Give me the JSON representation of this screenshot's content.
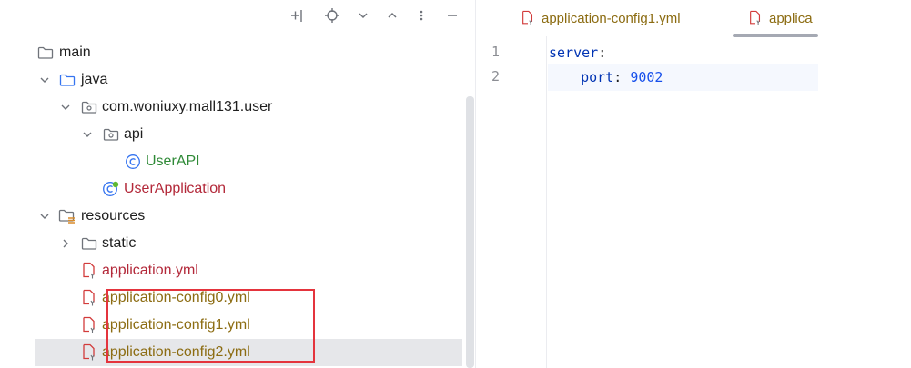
{
  "project_tree": {
    "items": [
      {
        "label": "main",
        "icon": "folder-icon",
        "expanded": null
      },
      {
        "label": "java",
        "icon": "source-folder-icon",
        "expanded": true
      },
      {
        "label": "com.woniuxy.mall131.user",
        "icon": "package-icon",
        "expanded": true
      },
      {
        "label": "api",
        "icon": "package-icon",
        "expanded": true
      },
      {
        "label": "UserAPI",
        "icon": "class-icon"
      },
      {
        "label": "UserApplication",
        "icon": "spring-boot-class-icon"
      },
      {
        "label": "resources",
        "icon": "resources-folder-icon",
        "expanded": true
      },
      {
        "label": "static",
        "icon": "folder-icon",
        "expanded": false
      },
      {
        "label": "application.yml",
        "icon": "yaml-file-icon"
      },
      {
        "label": "application-config0.yml",
        "icon": "yaml-file-icon"
      },
      {
        "label": "application-config1.yml",
        "icon": "yaml-file-icon"
      },
      {
        "label": "application-config2.yml",
        "icon": "yaml-file-icon"
      }
    ]
  },
  "editor": {
    "tabs": [
      {
        "label": "application-config1.yml"
      },
      {
        "label": "applica"
      }
    ],
    "line_numbers": [
      "1",
      "2"
    ],
    "code": {
      "line1_key": "server",
      "line1_colon": ":",
      "line2_indent": "    ",
      "line2_key": "port",
      "line2_sep": ": ",
      "line2_value": "9002"
    }
  },
  "colors": {
    "highlight_box": "#e4343d",
    "selected_row": "#e6e7ea",
    "yaml_key": "#0033b3",
    "number": "#1750eb",
    "modified_file": "#8c6c12",
    "error_file": "#b3293a",
    "class_name": "#2f8a37"
  }
}
